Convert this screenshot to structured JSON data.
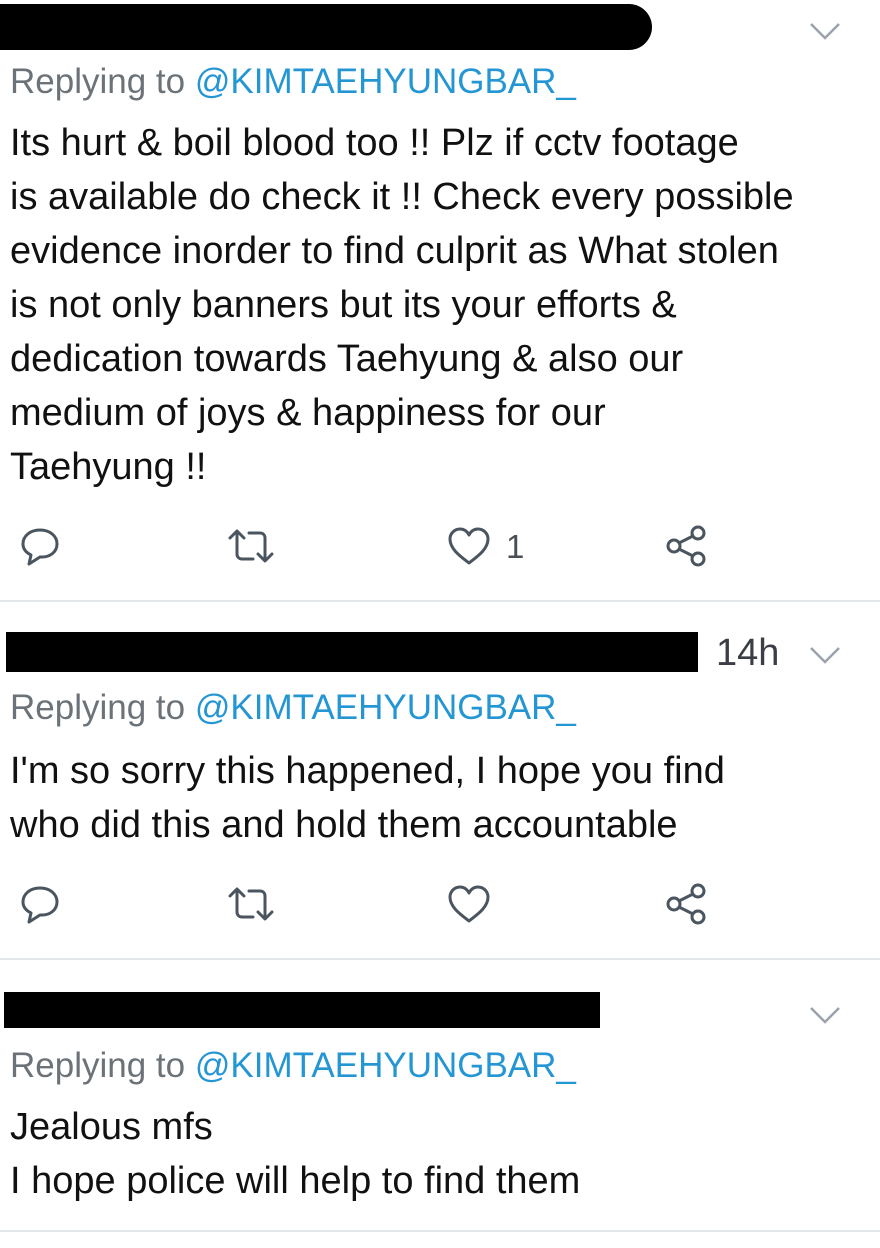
{
  "colors": {
    "link": "#2596d4",
    "muted": "#6b7278",
    "icon": "#4a5560",
    "divider": "#e3e7ea",
    "redaction": "#000000"
  },
  "tweets": [
    {
      "timestamp": "",
      "reply_prefix": "Replying to",
      "reply_handle": "@KIMTAEHYUNGBAR_",
      "lines": [
        "Its hurt & boil blood too !!  Plz if cctv footage",
        "is available do check it !! Check every possible",
        "evidence inorder to find culprit as What stolen",
        "is not only banners but its your efforts &",
        "dedication towards Taehyung & also our",
        "medium of joys & happiness for our",
        "Taehyung !!"
      ],
      "like_count": "1",
      "icons": [
        "reply-icon",
        "retweet-icon",
        "like-icon",
        "share-icon",
        "chevron-down-icon"
      ]
    },
    {
      "timestamp": "14h",
      "reply_prefix": "Replying to",
      "reply_handle": "@KIMTAEHYUNGBAR_",
      "lines": [
        "I'm so sorry this happened, I hope you find",
        "who did this and hold them accountable"
      ],
      "like_count": "",
      "icons": [
        "reply-icon",
        "retweet-icon",
        "like-icon",
        "share-icon",
        "chevron-down-icon"
      ]
    },
    {
      "timestamp": "",
      "reply_prefix": "Replying to",
      "reply_handle": "@KIMTAEHYUNGBAR_",
      "lines": [
        "Jealous mfs",
        "I hope police will help to find them"
      ],
      "like_count": "",
      "icons": [
        "chevron-down-icon"
      ]
    }
  ]
}
